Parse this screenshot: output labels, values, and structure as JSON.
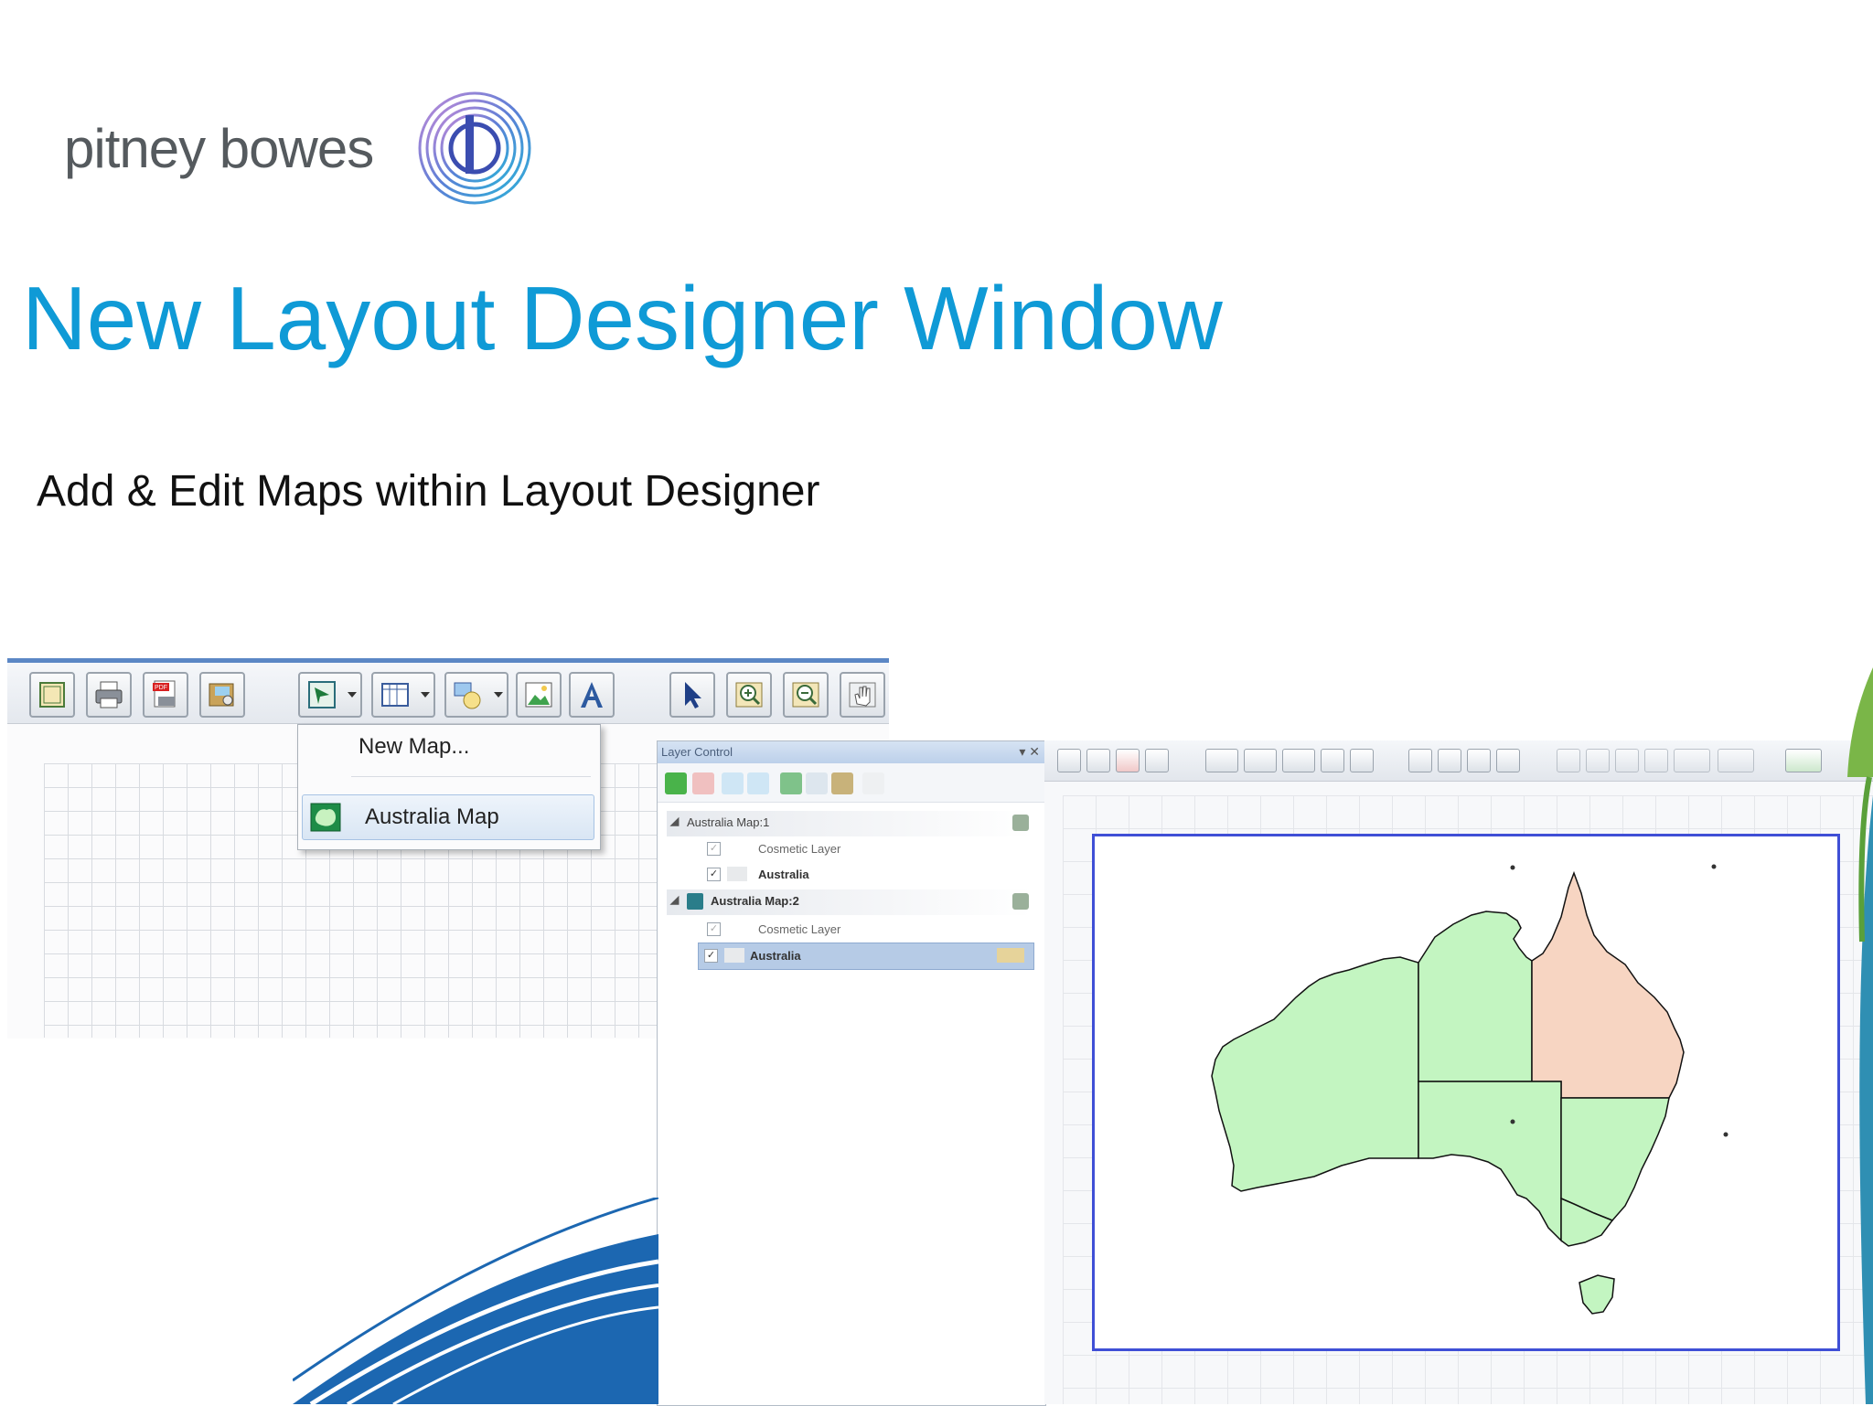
{
  "brand": {
    "logo_text": "pitney bowes"
  },
  "slide": {
    "title": "New Layout Designer Window",
    "subtitle": "Add & Edit Maps within Layout Designer"
  },
  "map_dropdown": {
    "new_map_label": "New Map...",
    "australia_map_label": "Australia Map"
  },
  "layer_control": {
    "title": "Layer Control",
    "title_buttons": "▾ ✕",
    "groups": [
      {
        "name": "Australia Map:1",
        "layers": [
          {
            "name": "Cosmetic Layer",
            "checked": true
          },
          {
            "name": "Australia",
            "checked": true
          }
        ]
      },
      {
        "name": "Australia Map:2",
        "layers": [
          {
            "name": "Cosmetic Layer",
            "checked": true
          },
          {
            "name": "Australia",
            "checked": true,
            "selected": true
          }
        ]
      }
    ]
  },
  "colors": {
    "title_blue": "#0f9ad6",
    "map_green": "#c3f5c1",
    "map_highlight": "#f7d5c2",
    "frame_blue": "#3f4fd6"
  }
}
